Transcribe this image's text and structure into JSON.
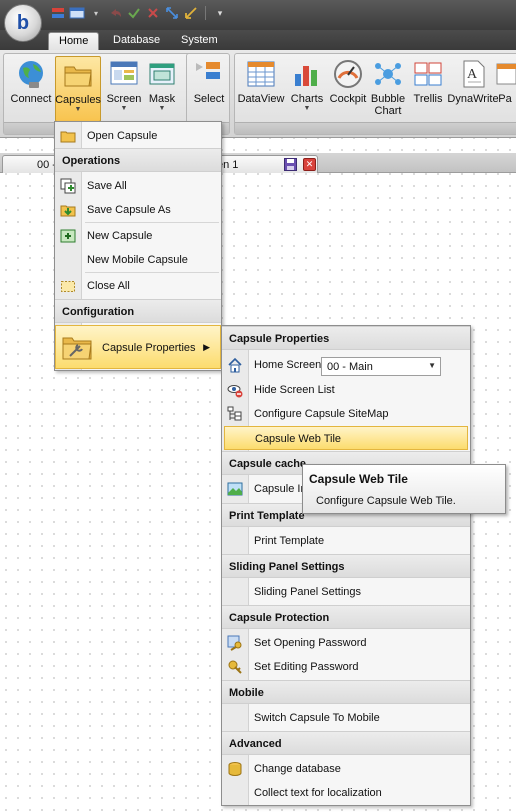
{
  "ribbon": {
    "tabs": [
      "Home",
      "Database",
      "System"
    ],
    "buttons": {
      "connect": "Connect",
      "capsules": "Capsules",
      "screen": "Screen",
      "mask": "Mask",
      "select": "Select",
      "dataview": "DataView",
      "charts": "Charts",
      "cockpit": "Cockpit",
      "bubble_chart": "Bubble Chart",
      "trellis": "Trellis",
      "dynawrite": "DynaWrite",
      "pa": "Pa"
    }
  },
  "document_tab": {
    "title_left": "00 -",
    "title_right": "en 1"
  },
  "capsules_menu": {
    "open_capsule": "Open Capsule",
    "operations_header": "Operations",
    "save_all": "Save All",
    "save_capsule_as": "Save Capsule As",
    "new_capsule": "New Capsule",
    "new_mobile_capsule": "New Mobile Capsule",
    "close_all": "Close All",
    "configuration_header": "Configuration",
    "capsule_properties": "Capsule Properties"
  },
  "properties_submenu": {
    "capsule_properties_header": "Capsule Properties",
    "home_screen_label": "Home Screen",
    "home_screen_value": "00 - Main",
    "hide_screen_list": "Hide Screen List",
    "configure_sitemap": "Configure Capsule SiteMap",
    "capsule_web_tile": "Capsule Web Tile",
    "capsule_cache_header": "Capsule cache",
    "capsule_image_partial": "Capsule Im",
    "print_template_header": "Print Template",
    "print_template": "Print Template",
    "sliding_panel_header": "Sliding Panel Settings",
    "sliding_panel_settings": "Sliding Panel Settings",
    "capsule_protection_header": "Capsule Protection",
    "set_opening_password": "Set Opening Password",
    "set_editing_password": "Set Editing Password",
    "mobile_header": "Mobile",
    "switch_to_mobile": "Switch Capsule To Mobile",
    "advanced_header": "Advanced",
    "change_database": "Change database",
    "collect_text": "Collect text for localization"
  },
  "tooltip": {
    "title": "Capsule Web Tile",
    "description": "Configure Capsule Web Tile."
  }
}
